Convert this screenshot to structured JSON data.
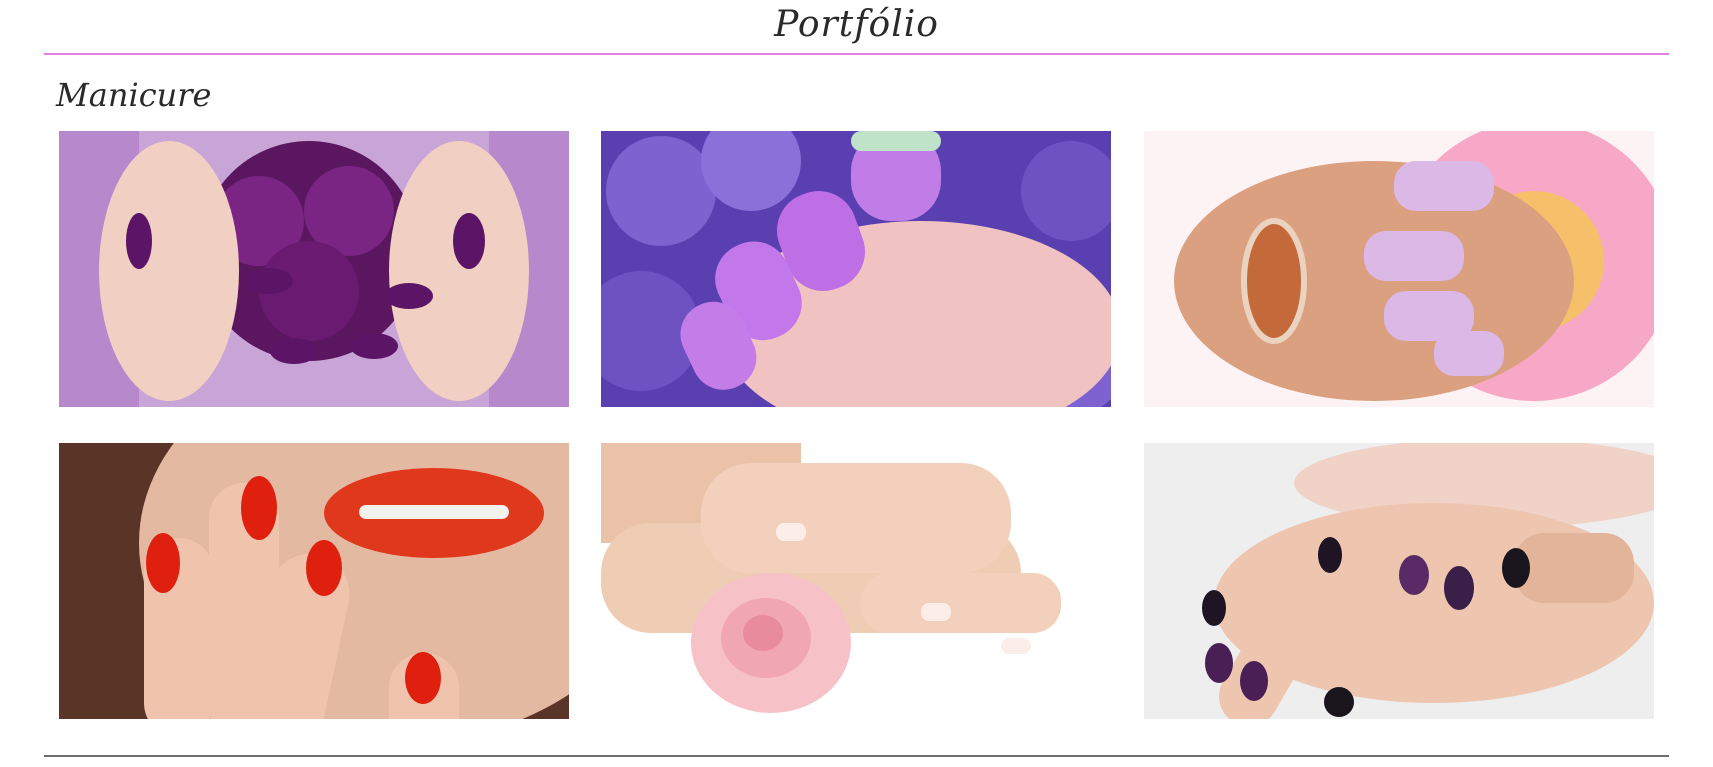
{
  "header": {
    "title": "Portfólio"
  },
  "section": {
    "title": "Manicure"
  },
  "gallery": [
    {
      "icon": "purple-nails-roses-photo",
      "accent": "#6a1a6e"
    },
    {
      "icon": "lilac-nails-flowers-photo",
      "accent": "#b870e0"
    },
    {
      "icon": "pink-nails-gerbera-photo",
      "accent": "#d8b8ea"
    },
    {
      "icon": "red-nails-lips-photo",
      "accent": "#e22a14"
    },
    {
      "icon": "french-nails-rose-photo",
      "accent": "#f3c9cf"
    },
    {
      "icon": "dark-nails-hands-photo",
      "accent": "#3a1f3e"
    }
  ],
  "colors": {
    "rule_top": "#e37fe3",
    "rule_bottom": "#6e6e6e",
    "text": "#2a2a2a"
  }
}
